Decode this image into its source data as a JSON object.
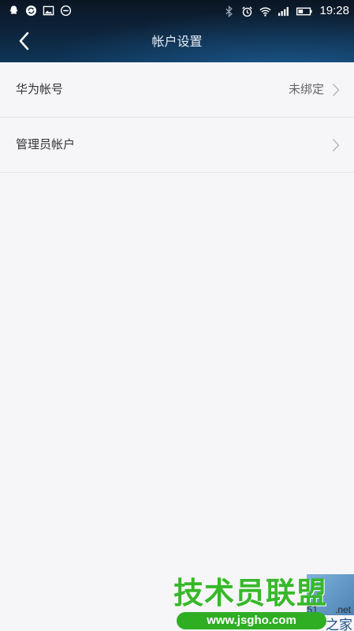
{
  "status_bar": {
    "time": "19:28",
    "left_icons": [
      "qq-icon",
      "sync-icon",
      "image-icon",
      "minus-circle-icon"
    ],
    "right_icons": [
      "bluetooth-icon",
      "alarm-icon",
      "wifi-icon",
      "signal-icon",
      "battery-icon"
    ]
  },
  "header": {
    "title": "帐户设置",
    "back_icon": "back-arrow-icon"
  },
  "list": {
    "items": [
      {
        "label": "华为帐号",
        "value": "未绑定",
        "icon": "chevron-right-icon"
      },
      {
        "label": "管理员帐户",
        "value": "",
        "icon": "chevron-right-icon"
      }
    ]
  },
  "watermark": {
    "main_text": "技术员联盟",
    "url": "www.jsgho.com",
    "side_number": "51",
    "side_net": ".net",
    "side_home": "之家"
  },
  "colors": {
    "header_top": "#0b1624",
    "header_bottom": "#0e3557",
    "background": "#f6f5f8",
    "row_label": "#333333",
    "row_value": "#666666",
    "divider": "#e3e2e6",
    "watermark_green": "#37b82a"
  }
}
